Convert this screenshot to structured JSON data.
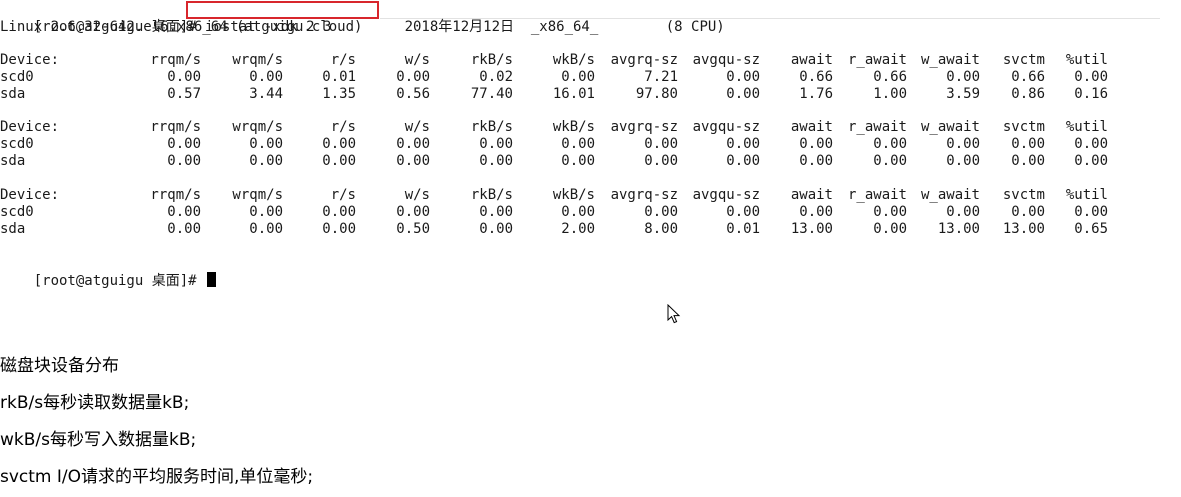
{
  "terminal": {
    "prompt_line": {
      "prompt": "[root@atguigu 桌面]# ",
      "command": "iostat -xdk 2 3"
    },
    "sysinfo": "Linux 2.6.32-642.el6.x86_64 (atguigu.cloud)     2018年12月12日  _x86_64_        (8 CPU)",
    "headers": [
      "Device:",
      "rrqm/s",
      "wrqm/s",
      "r/s",
      "w/s",
      "rkB/s",
      "wkB/s",
      "avgrq-sz",
      "avgqu-sz",
      "await",
      "r_await",
      "w_await",
      "svctm",
      "%util"
    ],
    "reports": [
      {
        "rows": [
          [
            "scd0",
            "0.00",
            "0.00",
            "0.01",
            "0.00",
            "0.02",
            "0.00",
            "7.21",
            "0.00",
            "0.66",
            "0.66",
            "0.00",
            "0.66",
            "0.00"
          ],
          [
            "sda",
            "0.57",
            "3.44",
            "1.35",
            "0.56",
            "77.40",
            "16.01",
            "97.80",
            "0.00",
            "1.76",
            "1.00",
            "3.59",
            "0.86",
            "0.16"
          ]
        ]
      },
      {
        "rows": [
          [
            "scd0",
            "0.00",
            "0.00",
            "0.00",
            "0.00",
            "0.00",
            "0.00",
            "0.00",
            "0.00",
            "0.00",
            "0.00",
            "0.00",
            "0.00",
            "0.00"
          ],
          [
            "sda",
            "0.00",
            "0.00",
            "0.00",
            "0.00",
            "0.00",
            "0.00",
            "0.00",
            "0.00",
            "0.00",
            "0.00",
            "0.00",
            "0.00",
            "0.00"
          ]
        ]
      },
      {
        "rows": [
          [
            "scd0",
            "0.00",
            "0.00",
            "0.00",
            "0.00",
            "0.00",
            "0.00",
            "0.00",
            "0.00",
            "0.00",
            "0.00",
            "0.00",
            "0.00",
            "0.00"
          ],
          [
            "sda",
            "0.00",
            "0.00",
            "0.00",
            "0.50",
            "0.00",
            "2.00",
            "8.00",
            "0.01",
            "13.00",
            "0.00",
            "13.00",
            "13.00",
            "0.65"
          ]
        ]
      }
    ],
    "final_prompt": "[root@atguigu 桌面]# "
  },
  "notes": [
    "磁盘块设备分布",
    "rkB/s每秒读取数据量kB;",
    "wkB/s每秒写入数据量kB;",
    "svctm I/O请求的平均服务时间,单位毫秒;"
  ],
  "colors": {
    "highlight_box": "#d8262c",
    "terminal_text": "#1a1a1a"
  },
  "icons": {
    "cursor": "terminal-block-cursor",
    "pointer": "mouse-pointer-icon"
  }
}
